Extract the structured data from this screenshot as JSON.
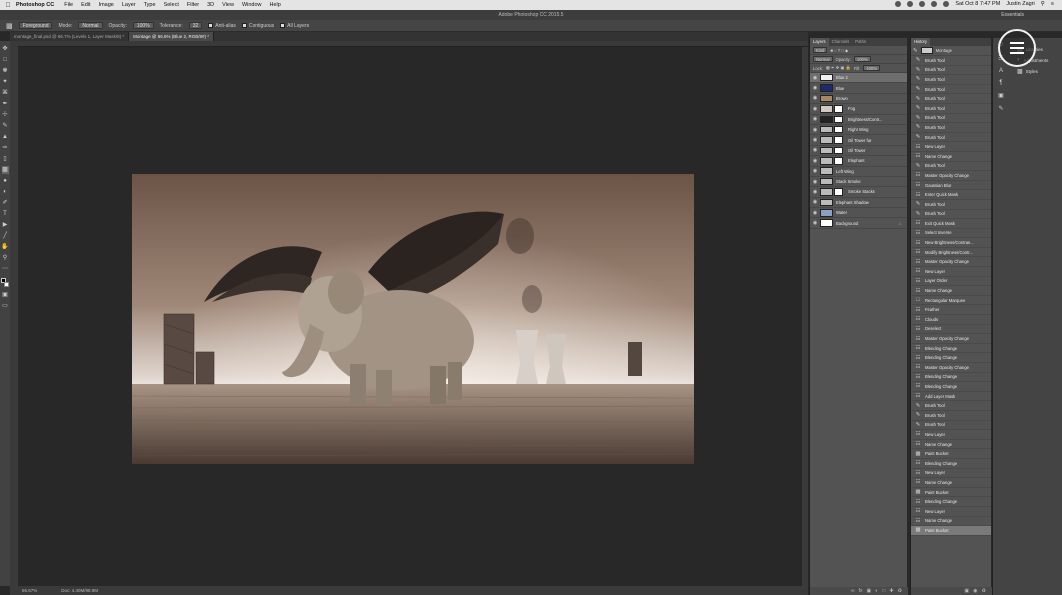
{
  "menubar": {
    "app_name": "Photoshop CC",
    "items": [
      "File",
      "Edit",
      "Image",
      "Layer",
      "Type",
      "Select",
      "Filter",
      "3D",
      "View",
      "Window",
      "Help"
    ],
    "clock": "Sat Oct 8  7:47 PM",
    "user": "Justin Zagri"
  },
  "window": {
    "title": "Adobe Photoshop CC 2015.5",
    "workspace": "Essentials"
  },
  "options_bar": {
    "sample_label": "Foreground",
    "mode_label": "Mode:",
    "mode_value": "Normal",
    "opacity_label": "Opacity:",
    "opacity_value": "100%",
    "tolerance_label": "Tolerance:",
    "tolerance_value": "32",
    "anti_alias": "Anti-alias",
    "contiguous": "Contiguous",
    "all_layers": "All Layers"
  },
  "doc_tabs": [
    {
      "label": "montage_final.psd @ 66.7% (Levels 1, Layer Mask/8) *",
      "active": false
    },
    {
      "label": "Montage @ 66.6% (Blue 2, RGB/8#) *",
      "active": true
    }
  ],
  "status": {
    "zoom": "66.67%",
    "doc": "Doc: 4.40M/98.9M"
  },
  "layers_panel": {
    "tabs": [
      "Layers",
      "Channels",
      "Paths"
    ],
    "kind_label": "Kind",
    "blend_mode": "Normal",
    "opacity_label": "Opacity:",
    "opacity_value": "100%",
    "lock_label": "Lock:",
    "fill_label": "Fill:",
    "fill_value": "100%",
    "layers": [
      {
        "name": "Blue 2",
        "thumb": "#f2f2f2",
        "mask": false,
        "selected": true
      },
      {
        "name": "Blue",
        "thumb": "#1e2a6e",
        "mask": false,
        "selected": false
      },
      {
        "name": "Brown",
        "thumb": "#a98763",
        "mask": false,
        "selected": false
      },
      {
        "name": "Fog",
        "thumb": "#cfc9c2",
        "mask": true,
        "selected": false
      },
      {
        "name": "Brightness/Contr...",
        "thumb": "#222222",
        "mask": true,
        "selected": false
      },
      {
        "name": "Right Wing",
        "thumb": "#bbbbbb",
        "mask": true,
        "selected": false
      },
      {
        "name": "Oil Tower far",
        "thumb": "#bbbbbb",
        "mask": true,
        "selected": false
      },
      {
        "name": "Oil Tower",
        "thumb": "#bbbbbb",
        "mask": true,
        "selected": false
      },
      {
        "name": "Elephant",
        "thumb": "#bbbbbb",
        "mask": true,
        "selected": false
      },
      {
        "name": "Left Wing",
        "thumb": "#bbbbbb",
        "mask": false,
        "selected": false
      },
      {
        "name": "Stack Smoke",
        "thumb": "#bbbbbb",
        "mask": false,
        "selected": false
      },
      {
        "name": "Smoke Stacks",
        "thumb": "#bbbbbb",
        "mask": true,
        "selected": false
      },
      {
        "name": "Elephant Shadow",
        "thumb": "#bbbbbb",
        "mask": false,
        "selected": false
      },
      {
        "name": "Water",
        "thumb": "#8aa0c2",
        "mask": false,
        "selected": false
      },
      {
        "name": "Background",
        "thumb": "#ffffff",
        "mask": false,
        "selected": false,
        "locked": true
      }
    ]
  },
  "history_panel": {
    "tab": "History",
    "snapshot": "Montage",
    "items": [
      {
        "label": "Brush Tool",
        "icon": "brush-icon"
      },
      {
        "label": "Brush Tool",
        "icon": "brush-icon"
      },
      {
        "label": "Brush Tool",
        "icon": "brush-icon"
      },
      {
        "label": "Brush Tool",
        "icon": "brush-icon"
      },
      {
        "label": "Brush Tool",
        "icon": "brush-icon"
      },
      {
        "label": "Brush Tool",
        "icon": "brush-icon"
      },
      {
        "label": "Brush Tool",
        "icon": "brush-icon"
      },
      {
        "label": "Brush Tool",
        "icon": "brush-icon"
      },
      {
        "label": "Brush Tool",
        "icon": "brush-icon"
      },
      {
        "label": "New Layer",
        "icon": "doc-icon"
      },
      {
        "label": "Name Change",
        "icon": "doc-icon"
      },
      {
        "label": "Brush Tool",
        "icon": "brush-icon"
      },
      {
        "label": "Master Opacity Change",
        "icon": "doc-icon"
      },
      {
        "label": "Gaussian Blur",
        "icon": "doc-icon"
      },
      {
        "label": "Enter Quick Mask",
        "icon": "doc-icon"
      },
      {
        "label": "Brush Tool",
        "icon": "brush-icon"
      },
      {
        "label": "Brush Tool",
        "icon": "brush-icon"
      },
      {
        "label": "Exit Quick Mask",
        "icon": "doc-icon"
      },
      {
        "label": "Select Inverse",
        "icon": "doc-icon"
      },
      {
        "label": "New Brightness/Contras...",
        "icon": "doc-icon"
      },
      {
        "label": "Modify Brightness/Contr...",
        "icon": "doc-icon"
      },
      {
        "label": "Master Opacity Change",
        "icon": "doc-icon"
      },
      {
        "label": "New Layer",
        "icon": "doc-icon"
      },
      {
        "label": "Layer Order",
        "icon": "doc-icon"
      },
      {
        "label": "Name Change",
        "icon": "doc-icon"
      },
      {
        "label": "Rectangular Marquee",
        "icon": "marquee-icon"
      },
      {
        "label": "Feather",
        "icon": "doc-icon"
      },
      {
        "label": "Clouds",
        "icon": "doc-icon"
      },
      {
        "label": "Deselect",
        "icon": "doc-icon"
      },
      {
        "label": "Master Opacity Change",
        "icon": "doc-icon"
      },
      {
        "label": "Blending Change",
        "icon": "doc-icon"
      },
      {
        "label": "Blending Change",
        "icon": "doc-icon"
      },
      {
        "label": "Master Opacity Change",
        "icon": "doc-icon"
      },
      {
        "label": "Blending Change",
        "icon": "doc-icon"
      },
      {
        "label": "Blending Change",
        "icon": "doc-icon"
      },
      {
        "label": "Add Layer Mask",
        "icon": "doc-icon"
      },
      {
        "label": "Brush Tool",
        "icon": "brush-icon"
      },
      {
        "label": "Brush Tool",
        "icon": "brush-icon"
      },
      {
        "label": "Brush Tool",
        "icon": "brush-icon"
      },
      {
        "label": "New Layer",
        "icon": "doc-icon"
      },
      {
        "label": "Name Change",
        "icon": "doc-icon"
      },
      {
        "label": "Paint Bucket",
        "icon": "bucket-icon"
      },
      {
        "label": "Blending Change",
        "icon": "doc-icon"
      },
      {
        "label": "New Layer",
        "icon": "doc-icon"
      },
      {
        "label": "Name Change",
        "icon": "doc-icon"
      },
      {
        "label": "Paint Bucket",
        "icon": "bucket-icon"
      },
      {
        "label": "Blending Change",
        "icon": "doc-icon"
      },
      {
        "label": "New Layer",
        "icon": "doc-icon"
      },
      {
        "label": "Name Change",
        "icon": "doc-icon"
      },
      {
        "label": "Paint Bucket",
        "icon": "bucket-icon",
        "selected": true
      }
    ]
  },
  "dock": {
    "libraries": "Libraries",
    "adjustments": "Adjustments",
    "styles": "Styles"
  }
}
